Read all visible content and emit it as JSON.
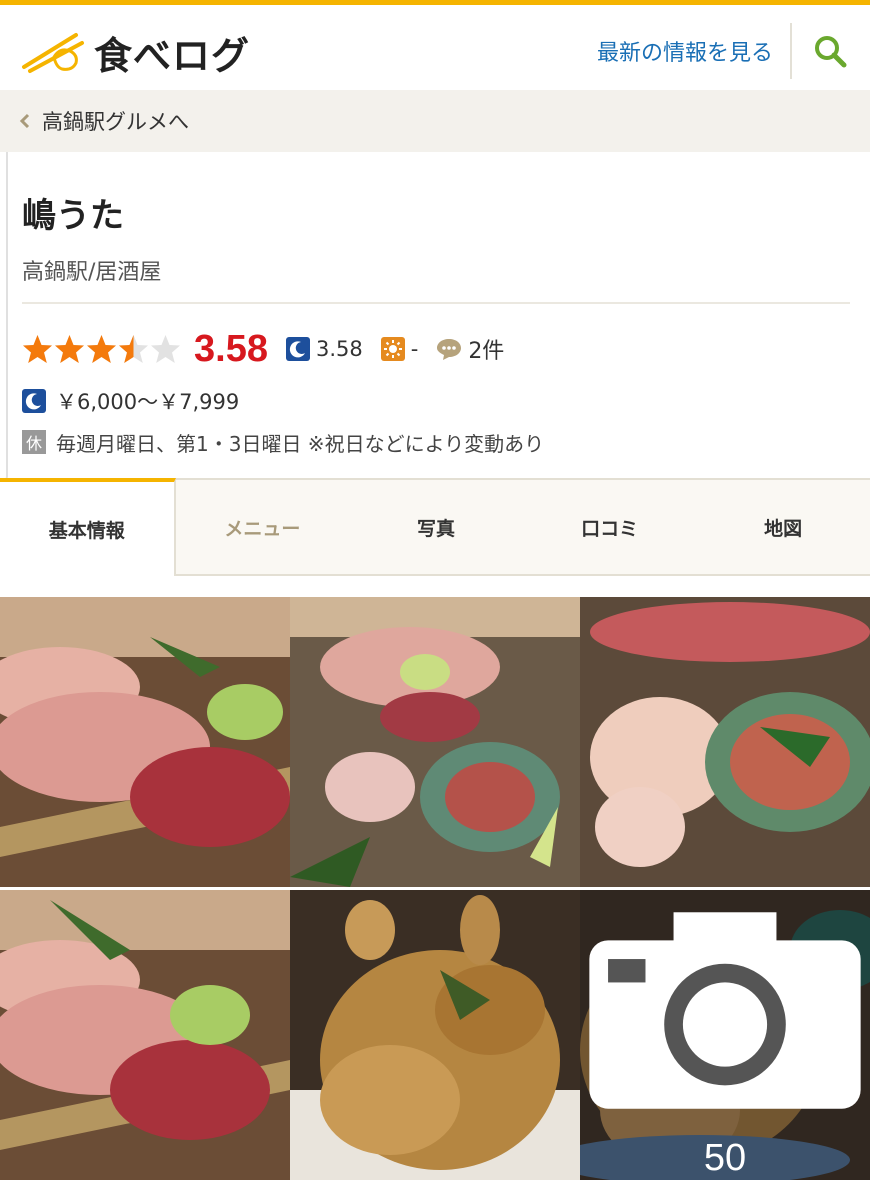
{
  "header": {
    "logo_text": "食べログ",
    "latest_link": "最新の情報を見る",
    "search_icon": "search-icon"
  },
  "breadcrumb": {
    "label": "高鍋駅グルメへ"
  },
  "shop": {
    "name": "嶋うた",
    "subtitle": "高鍋駅/居酒屋"
  },
  "rating": {
    "stars_filled": 3.5,
    "stars_total": 5,
    "score": "3.58",
    "dinner_score": "3.58",
    "lunch_score": "-",
    "review_count": "2件"
  },
  "price": {
    "dinner": "￥6,000～￥7,999"
  },
  "holiday": {
    "badge": "休",
    "text": "毎週月曜日、第1・3日曜日 ※祝日などにより変動あり"
  },
  "tabs": [
    {
      "label": "基本情報"
    },
    {
      "label": "メニュー"
    },
    {
      "label": "写真"
    },
    {
      "label": "口コミ"
    },
    {
      "label": "地図"
    }
  ],
  "gallery": {
    "photo_count": "50"
  },
  "colors": {
    "accent": "#f5b400",
    "score_red": "#d7181e",
    "star_orange": "#f47a0c",
    "link_blue": "#1a6fb5"
  }
}
